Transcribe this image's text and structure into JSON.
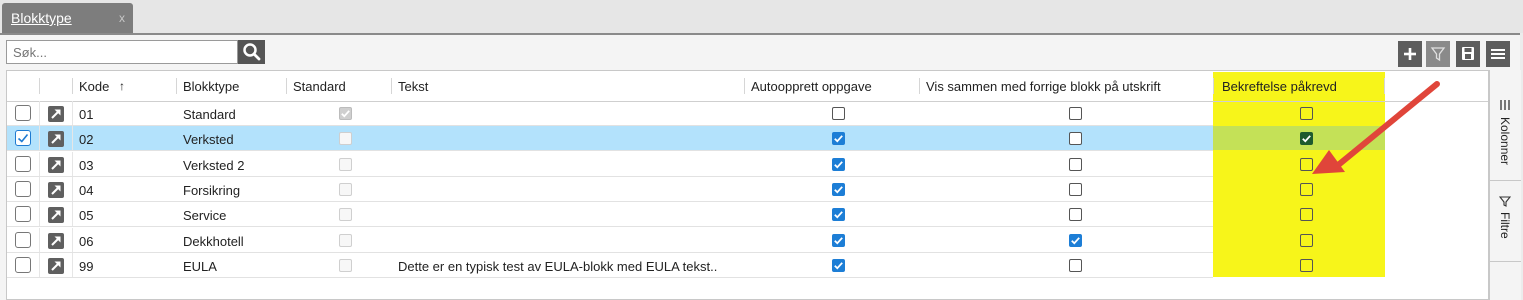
{
  "tab": {
    "title": "Blokktype",
    "close": "x"
  },
  "search": {
    "placeholder": "Søk..."
  },
  "columns": {
    "kode": "Kode",
    "sort_arrow": "↑",
    "blokktype": "Blokktype",
    "standard": "Standard",
    "tekst": "Tekst",
    "autoopprett": "Autoopprett oppgave",
    "vis_sammen": "Vis sammen med forrige blokk på utskrift",
    "bekreftelse": "Bekreftelse påkrevd"
  },
  "rows": [
    {
      "kode": "01",
      "blokktype": "Standard",
      "standard": true,
      "tekst": "",
      "autoopprett": false,
      "vis_sammen": false,
      "bekreftelse": false,
      "selected": false
    },
    {
      "kode": "02",
      "blokktype": "Verksted",
      "standard": false,
      "tekst": "",
      "autoopprett": true,
      "vis_sammen": false,
      "bekreftelse": true,
      "selected": true
    },
    {
      "kode": "03",
      "blokktype": "Verksted 2",
      "standard": false,
      "tekst": "",
      "autoopprett": true,
      "vis_sammen": false,
      "bekreftelse": false,
      "selected": false
    },
    {
      "kode": "04",
      "blokktype": "Forsikring",
      "standard": false,
      "tekst": "",
      "autoopprett": true,
      "vis_sammen": false,
      "bekreftelse": false,
      "selected": false
    },
    {
      "kode": "05",
      "blokktype": "Service",
      "standard": false,
      "tekst": "",
      "autoopprett": true,
      "vis_sammen": false,
      "bekreftelse": false,
      "selected": false
    },
    {
      "kode": "06",
      "blokktype": "Dekkhotell",
      "standard": false,
      "tekst": "",
      "autoopprett": true,
      "vis_sammen": true,
      "bekreftelse": false,
      "selected": false
    },
    {
      "kode": "99",
      "blokktype": "EULA",
      "standard": false,
      "tekst": "Dette er en typisk test av EULA-blokk med EULA tekst..",
      "autoopprett": true,
      "vis_sammen": false,
      "bekreftelse": false,
      "selected": false
    }
  ],
  "side_panel": {
    "columns_label": "Kolonner",
    "filter_label": "Filtre"
  },
  "toolbar_icons": [
    "plus-icon",
    "filter-icon",
    "save-icon",
    "menu-icon"
  ],
  "colors": {
    "highlight": "#f7f51a",
    "selected_row": "#b3e2fc",
    "checkbox_blue": "#1d7ed6",
    "annotation_arrow": "#e0453a"
  }
}
